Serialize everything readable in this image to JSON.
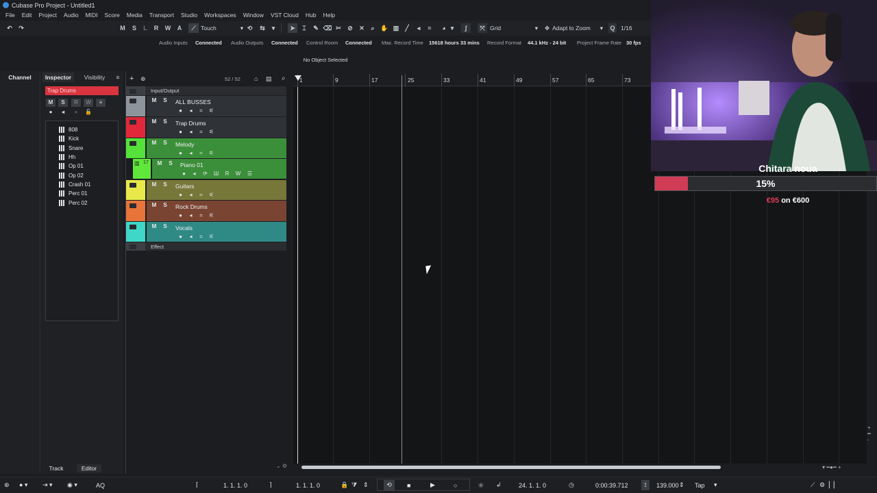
{
  "window": {
    "title": "Cubase Pro Project - Untitled1"
  },
  "menu": [
    "File",
    "Edit",
    "Project",
    "Audio",
    "MIDI",
    "Score",
    "Media",
    "Transport",
    "Studio",
    "Workspaces",
    "Window",
    "VST Cloud",
    "Hub",
    "Help"
  ],
  "toolbar": {
    "buttons": [
      "M",
      "S",
      "L",
      "R",
      "W",
      "A"
    ],
    "automation_mode": "Touch",
    "grid_type": "Grid",
    "zoom_mode": "Adapt to Zoom",
    "quantize": "1/16"
  },
  "status": {
    "audio_inputs_label": "Audio Inputs",
    "audio_inputs_value": "Connected",
    "audio_outputs_label": "Audio Outputs",
    "audio_outputs_value": "Connected",
    "control_room_label": "Control Room",
    "control_room_value": "Connected",
    "max_record_label": "Max. Record Time",
    "max_record_value": "15618 hours 33 mins",
    "record_format_label": "Record Format",
    "record_format_value": "44.1 kHz - 24 bit",
    "frame_rate_label": "Project Frame Rate",
    "frame_rate_value": "30 fps"
  },
  "info_line": "No Object Selected",
  "left_tabs": {
    "channel": "Channel",
    "inspector": "Inspector",
    "visibility": "Visibility"
  },
  "inspector": {
    "selected_track": "Trap Drums",
    "buttons": [
      "M",
      "S",
      "R",
      "W"
    ],
    "drum_items": [
      "808",
      "Kick",
      "Snare",
      "Hh",
      "Op 01",
      "Op 02",
      "Crash 01",
      "Perc 01",
      "Perc 02"
    ]
  },
  "bottom_tabs": {
    "track": "Track",
    "editor": "Editor"
  },
  "tracklist": {
    "count": "52 / 52",
    "input_output": "Input/Output",
    "effect": "Effect",
    "tracks": [
      {
        "name": "ALL BUSSES",
        "color": "#8e949b",
        "bg": "#2f3236"
      },
      {
        "name": "Trap Drums",
        "color": "#e0283a",
        "bg": "#2f3236"
      },
      {
        "name": "Melody",
        "color": "#55e23a",
        "bg": "#3c8f3a"
      },
      {
        "name": "Piano 01",
        "color": "#5fe83b",
        "bg": "#3c8f3a",
        "number": "17"
      },
      {
        "name": "Guitars",
        "color": "#e8e84a",
        "bg": "#77773a"
      },
      {
        "name": "Rock Drums",
        "color": "#e8743a",
        "bg": "#7a4432"
      },
      {
        "name": "Vocals",
        "color": "#3fd8c8",
        "bg": "#2f8a86"
      }
    ]
  },
  "ruler": {
    "bars": [
      "1",
      "9",
      "17",
      "25",
      "33",
      "41",
      "49",
      "57",
      "65",
      "73"
    ]
  },
  "transport": {
    "left_locator": "1. 1. 1.   0",
    "right_locator": "1. 1. 1.   0",
    "position": "24. 1. 1.   0",
    "time": "0:00:39.712",
    "tempo": "139.000",
    "tap": "Tap"
  },
  "overlay": {
    "goal_title": "Chitara noua",
    "goal_percent_text": "15%",
    "goal_fraction": 0.15,
    "goal_raised": "€95",
    "goal_on": "on",
    "goal_target": "€600"
  }
}
